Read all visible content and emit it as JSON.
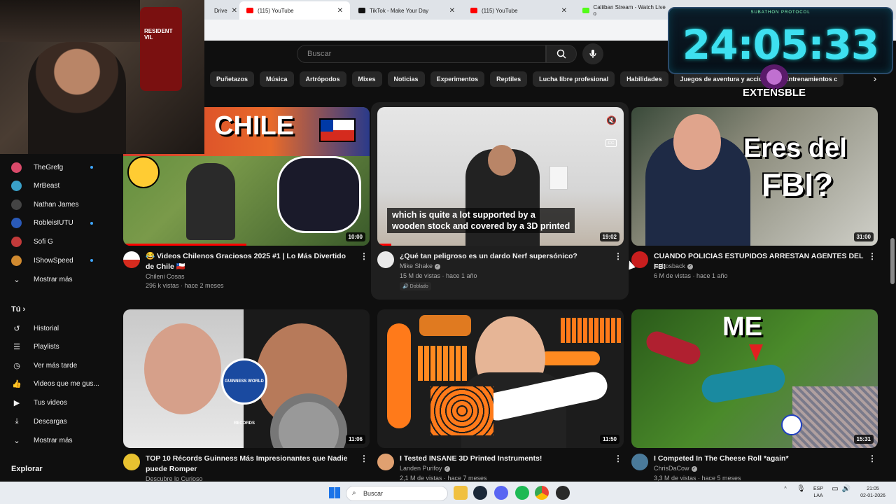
{
  "browser": {
    "tabs": [
      {
        "label": "Drive"
      },
      {
        "label": "(115) YouTube",
        "active": true
      },
      {
        "label": "TikTok - Make Your Day"
      },
      {
        "label": "(115) YouTube"
      },
      {
        "label": "Caliiban Stream - Watch Live o"
      }
    ]
  },
  "youtube": {
    "search_placeholder": "Buscar",
    "chips": [
      "Puñetazos",
      "Música",
      "Artrópodos",
      "Mixes",
      "Noticias",
      "Experimentos",
      "Reptiles",
      "Lucha libre profesional",
      "Habilidades",
      "Juegos de aventura y acción",
      "Entrenamientos c"
    ]
  },
  "overlay": {
    "timer_label": "SUBATHON PROTOCOL",
    "timer": "24:05:33",
    "brand": "EXTENSBLE",
    "webcam_chair_text": "RESIDENT VIL"
  },
  "sidebar": {
    "subscriptions": [
      {
        "name": "TheGrefg",
        "color": "#d94a6a",
        "dot": true
      },
      {
        "name": "MrBeast",
        "color": "#3aa0c8",
        "dot": false
      },
      {
        "name": "Nathan James",
        "color": "#444444",
        "dot": false
      },
      {
        "name": "RobleisIUTU",
        "color": "#2a5ab8",
        "dot": true
      },
      {
        "name": "Sofi G",
        "color": "#c23a3a",
        "dot": false
      },
      {
        "name": "IShowSpeed",
        "color": "#d08a30",
        "dot": true
      }
    ],
    "show_more_1": "Mostrar más",
    "you_header": "Tú",
    "you_items": [
      "Historial",
      "Playlists",
      "Ver más tarde",
      "Videos que me gus...",
      "Tus videos",
      "Descargas"
    ],
    "show_more_2": "Mostrar más",
    "explore_header": "Explorar"
  },
  "videos": [
    {
      "title": "😂 Videos Chilenos Graciosos 2025 #1 | Lo Más Divertido de Chile 🇨🇱",
      "channel": "Chileni Cosas",
      "stats": "296 k vistas · hace 2 meses",
      "duration": "10:00",
      "thumb_text": "CHILE",
      "verified": false
    },
    {
      "title": "¿Qué tan peligroso es un dardo Nerf supersónico?",
      "channel": "Mike Shake",
      "stats": "15 M de vistas · hace 1 año",
      "duration": "19:02",
      "caption_line1": "which is quite a lot supported by a",
      "caption_line2": "wooden stock and covered by a 3D printed",
      "badge": "Doblado",
      "verified": true
    },
    {
      "title": "CUANDO POLICIAS ESTUPIDOS ARRESTAN AGENTES DEL FBI",
      "channel": "luchosback",
      "stats": "6 M de vistas · hace 1 año",
      "duration": "31:00",
      "thumb_text1": "Eres del",
      "thumb_text2": "FBI?",
      "verified": true
    },
    {
      "title": "TOP 10 Récords Guinness Más Impresionantes que Nadie puede Romper",
      "channel": "Descubre lo Curioso",
      "stats": "",
      "duration": "11:06",
      "thumb_text": "GUINNESS WORLD RECORDS",
      "verified": false
    },
    {
      "title": "I Tested INSANE 3D Printed Instruments!",
      "channel": "Landen Purifoy",
      "stats": "2,1 M de vistas · hace 7 meses",
      "duration": "11:50",
      "verified": true
    },
    {
      "title": "I Competed In The Cheese Roll *again*",
      "channel": "ChrisDaCow",
      "stats": "3,3 M de vistas · hace 5 meses",
      "duration": "15:31",
      "thumb_text": "ME",
      "verified": true
    }
  ],
  "taskbar": {
    "search": "Buscar",
    "lang": "ESP",
    "lang2": "LAA",
    "time": "21:05",
    "date": "02-01-2026"
  }
}
